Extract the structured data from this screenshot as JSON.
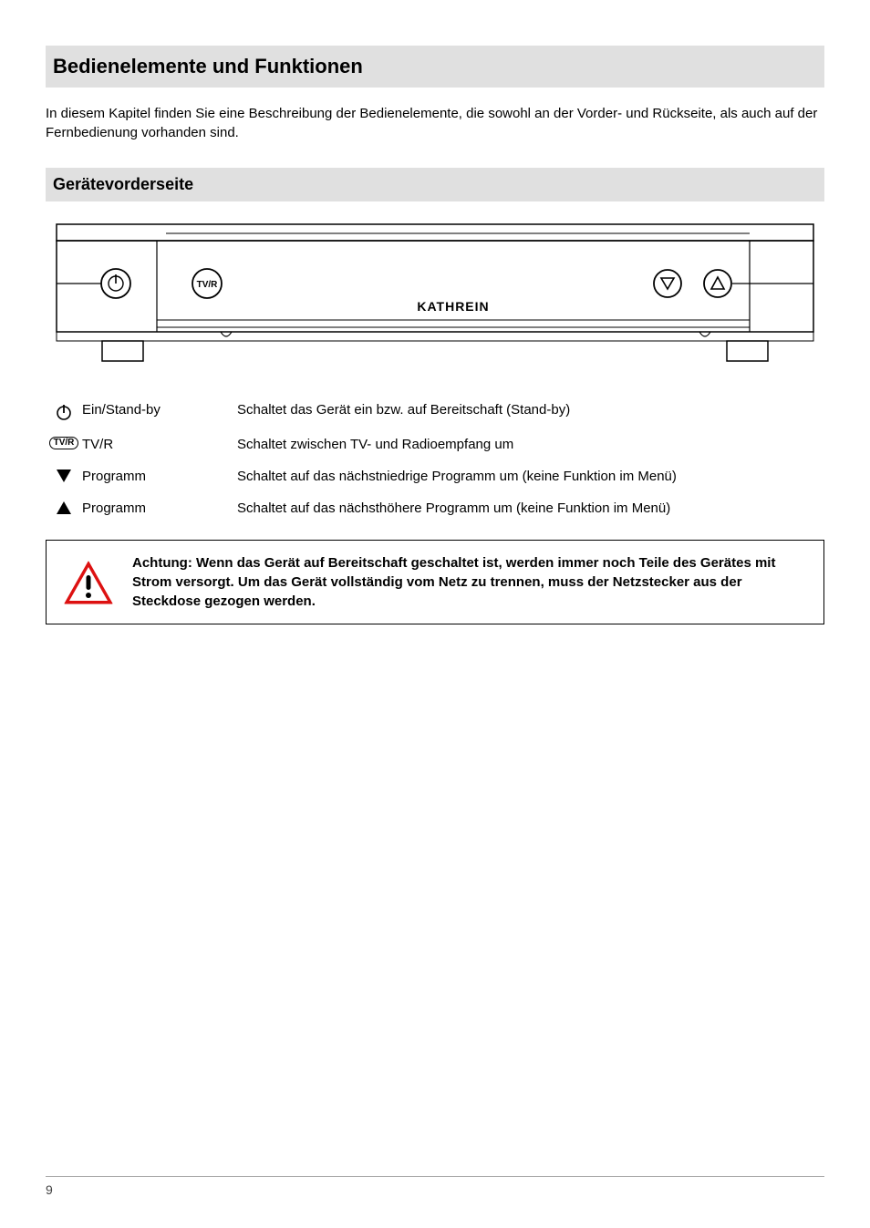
{
  "title": "Bedienelemente und Funktionen",
  "intro": "In diesem Kapitel finden Sie eine Beschreibung der Bedienelemente, die sowohl an der Vorder- und Rückseite, als auch auf der Fernbedienung vorhanden sind.",
  "section_front": "Gerätevorderseite",
  "device_brand": "KATHREIN",
  "defs": {
    "power": {
      "symbol_name": "power-icon",
      "label": "Ein/Stand-by",
      "desc": "Schaltet das Gerät ein bzw. auf Bereitschaft (Stand-by)"
    },
    "tvr": {
      "symbol_text": "TV/R",
      "label": "TV/R",
      "desc": "Schaltet zwischen TV- und Radioempfang um"
    },
    "down": {
      "symbol_name": "triangle-down",
      "label": "Programm",
      "desc": "Schaltet auf das nächstniedrige Programm um (keine Funktion im Menü)"
    },
    "up": {
      "symbol_name": "triangle-up",
      "label": "Programm",
      "desc": "Schaltet auf das nächsthöhere Programm um (keine Funktion im Menü)"
    }
  },
  "warning": "Achtung: Wenn das Gerät auf Bereitschaft geschaltet ist, werden immer noch Teile des Gerätes mit Strom versorgt. Um das Gerät vollständig vom Netz zu trennen, muss der Netzstecker aus der Steckdose gezogen werden.",
  "page_number": "9"
}
